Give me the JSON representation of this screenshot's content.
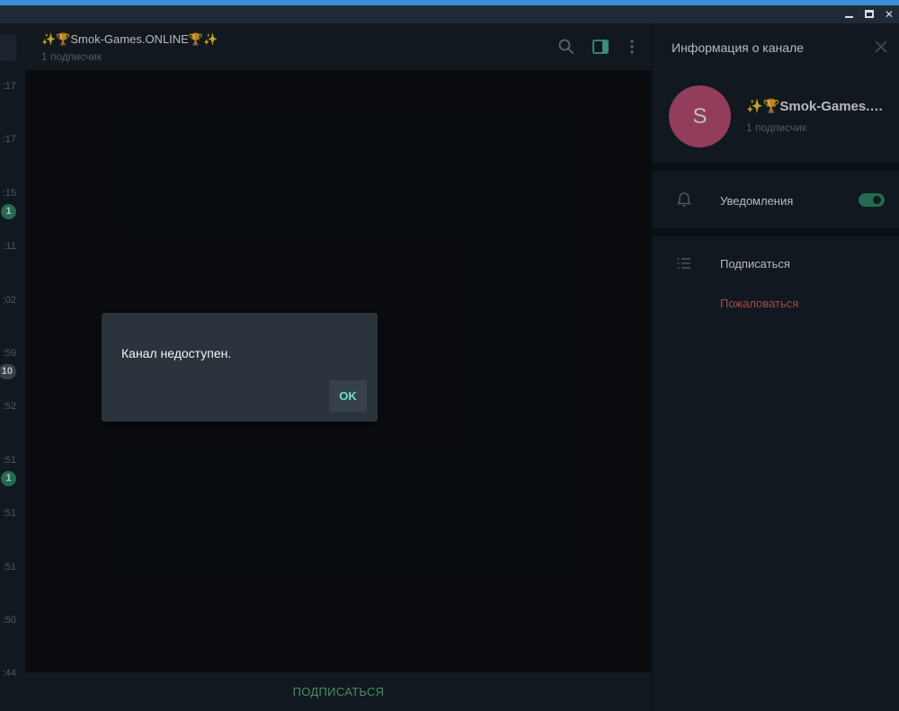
{
  "window": {
    "controls": {
      "minimize": "_",
      "maximize": "□",
      "close": "✕"
    }
  },
  "chat_list": {
    "items": [
      {
        "time": ":17",
        "badge": ""
      },
      {
        "time": ":17",
        "badge": ""
      },
      {
        "time": ":15",
        "badge": "1",
        "badge_color": "#2f8f6c"
      },
      {
        "time": ":11",
        "badge": ""
      },
      {
        "time": ":02",
        "badge": ""
      },
      {
        "time": ":59",
        "badge": "10",
        "badge_color": "#4a5561"
      },
      {
        "time": ":52",
        "badge": ""
      },
      {
        "time": ":51",
        "badge": "1",
        "badge_color": "#2f8f6c"
      },
      {
        "time": ":51",
        "badge": ""
      },
      {
        "time": ":51",
        "badge": ""
      },
      {
        "time": ":50",
        "badge": ""
      },
      {
        "time": ":44",
        "badge": ""
      }
    ]
  },
  "chat": {
    "title": "✨🏆Smok-Games.ONLINE🏆✨",
    "subtitle": "1 подписчик",
    "icons": [
      "search-icon",
      "side-panel-icon",
      "more-icon"
    ],
    "join_button": "ПОДПИСАТЬСЯ"
  },
  "info_panel": {
    "header": "Информация о канале",
    "avatar_letter": "S",
    "avatar_color": "#c2527a",
    "channel_name": "✨🏆Smok-Games.ONLINE🏆✨",
    "subscribers": "1 подписчик",
    "notifications_label": "Уведомления",
    "notifications_on": true,
    "subscribe_label": "Подписаться",
    "report_label": "Пожаловаться",
    "report_color": "#e35f5f"
  },
  "modal": {
    "message": "Канал недоступен.",
    "ok_label": "OK"
  },
  "colors": {
    "accent": "#2f8f6c",
    "titlebar_strip": "#3a8fd6"
  }
}
